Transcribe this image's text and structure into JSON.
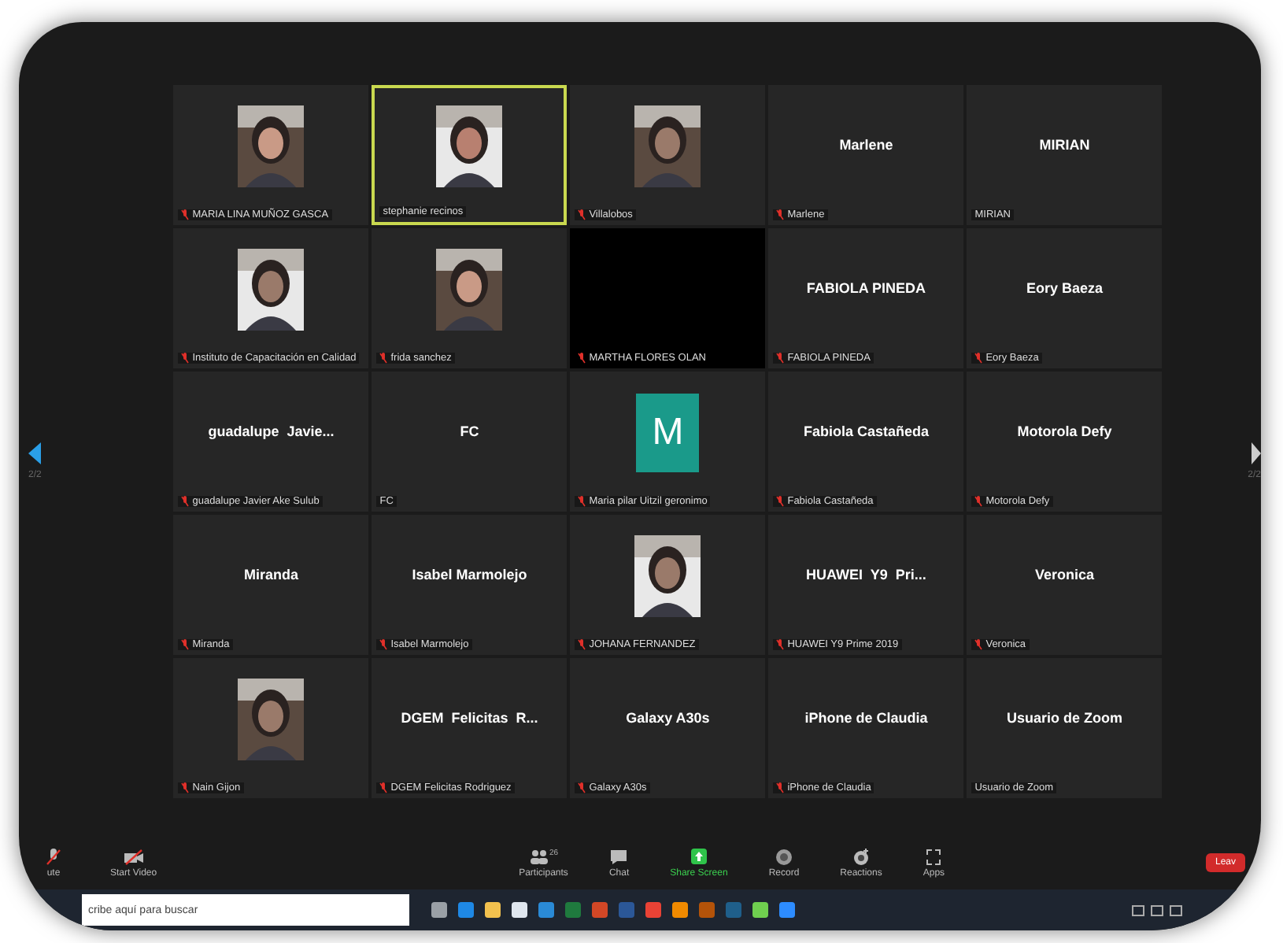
{
  "pager": {
    "left": "2/2",
    "right": "2/2"
  },
  "tiles": [
    {
      "label": "MARIA LINA MUÑOZ GASCA",
      "muted": true,
      "speaking": false
    },
    {
      "label": "stephanie recinos",
      "muted": false,
      "speaking": true
    },
    {
      "label": "Villalobos",
      "muted": true,
      "speaking": false
    },
    {
      "kind": "name",
      "display": "Marlene",
      "label": "Marlene",
      "muted": true,
      "speaking": false
    },
    {
      "kind": "name",
      "display": "MIRIAN",
      "label": "MIRIAN",
      "muted": false,
      "speaking": false
    },
    {
      "label": "Instituto de Capacitación en Calidad",
      "muted": true,
      "speaking": false
    },
    {
      "label": "frida sanchez",
      "muted": true,
      "speaking": false
    },
    {
      "kind": "video_off",
      "label": "MARTHA FLORES OLAN",
      "muted": true,
      "speaking": false
    },
    {
      "kind": "name",
      "display": "FABIOLA PINEDA",
      "label": "FABIOLA PINEDA",
      "muted": true,
      "speaking": false
    },
    {
      "kind": "name",
      "display": "Eory Baeza",
      "label": "Eory Baeza",
      "muted": true,
      "speaking": false
    },
    {
      "kind": "name",
      "display": "guadalupe  Javie...",
      "label": "guadalupe Javier Ake Sulub",
      "muted": true,
      "speaking": false
    },
    {
      "kind": "name",
      "display": "FC",
      "label": "FC",
      "muted": false,
      "speaking": false
    },
    {
      "kind": "avatar",
      "display": "M",
      "label": "Maria pilar Uitzil geronimo",
      "muted": true,
      "speaking": false
    },
    {
      "kind": "name",
      "display": "Fabiola Castañeda",
      "label": "Fabiola Castañeda",
      "muted": true,
      "speaking": false
    },
    {
      "kind": "name",
      "display": "Motorola Defy",
      "label": "Motorola Defy",
      "muted": true,
      "speaking": false
    },
    {
      "kind": "name",
      "display": "Miranda",
      "label": "Miranda",
      "muted": true,
      "speaking": false
    },
    {
      "kind": "name",
      "display": "Isabel Marmolejo",
      "label": "Isabel Marmolejo",
      "muted": true,
      "speaking": false
    },
    {
      "label": "JOHANA FERNANDEZ",
      "muted": true,
      "speaking": false
    },
    {
      "kind": "name",
      "display": "HUAWEI  Y9  Pri...",
      "label": "HUAWEI Y9 Prime 2019",
      "muted": true,
      "speaking": false
    },
    {
      "kind": "name",
      "display": "Veronica",
      "label": "Veronica",
      "muted": true,
      "speaking": false
    },
    {
      "label": "Nain Gijon",
      "muted": true,
      "speaking": false
    },
    {
      "kind": "name",
      "display": "DGEM  Felicitas  R...",
      "label": "DGEM Felicitas Rodriguez",
      "muted": true,
      "speaking": false
    },
    {
      "kind": "name",
      "display": "Galaxy A30s",
      "label": "Galaxy A30s",
      "muted": true,
      "speaking": false
    },
    {
      "kind": "name",
      "display": "iPhone de Claudia",
      "label": "iPhone de Claudia",
      "muted": true,
      "speaking": false
    },
    {
      "kind": "name",
      "display": "Usuario de Zoom",
      "label": "Usuario de Zoom",
      "muted": false,
      "speaking": false
    }
  ],
  "toolbar": [
    {
      "kind": "mute",
      "label": "ute"
    },
    {
      "kind": "video",
      "label": "Start Video"
    },
    {
      "kind": "participants",
      "label": "Participants",
      "count": "26"
    },
    {
      "kind": "chat",
      "label": "Chat"
    },
    {
      "kind": "share",
      "label": "Share Screen"
    },
    {
      "kind": "record",
      "label": "Record"
    },
    {
      "kind": "reactions",
      "label": "Reactions"
    },
    {
      "kind": "apps",
      "label": "Apps"
    }
  ],
  "leave_button": "Leav",
  "taskbar": {
    "search": {
      "placeholder": "cribe aquí para buscar"
    },
    "apps": [
      {
        "color": "#9aa0a6"
      },
      {
        "color": "#1e88e5"
      },
      {
        "color": "#f2c14e"
      },
      {
        "color": "#dfe6ee"
      },
      {
        "color": "#2a8ad6"
      },
      {
        "color": "#1f7a3e"
      },
      {
        "color": "#d24726"
      },
      {
        "color": "#2b5797"
      },
      {
        "color": "#e94235"
      },
      {
        "color": "#f08a00"
      },
      {
        "color": "#b45309"
      },
      {
        "color": "#1f5f8b"
      },
      {
        "color": "#6fcf4f"
      },
      {
        "color": "#2d8cff"
      }
    ]
  }
}
